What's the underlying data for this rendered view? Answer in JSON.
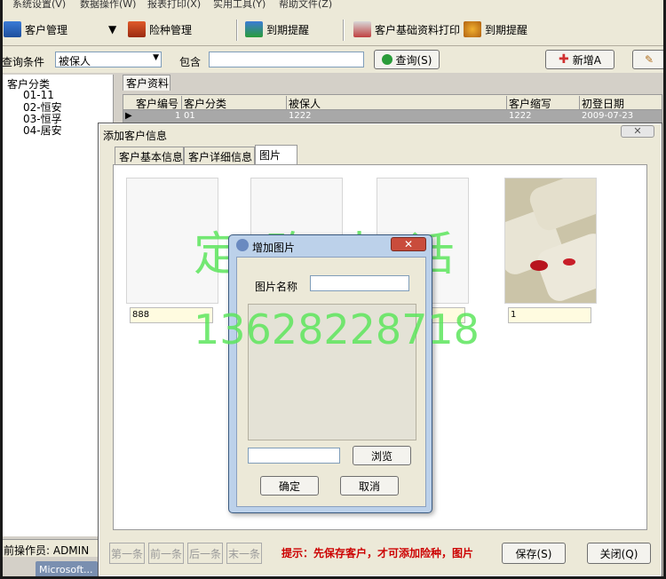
{
  "menu": [
    "系统设置(V)",
    "数据操作(W)",
    "报表打印(X)",
    "实用工具(Y)",
    "帮助文件(Z)"
  ],
  "toolbar": {
    "customer_mgmt": "客户管理",
    "insurance_mgmt": "险种管理",
    "due_reminder_1": "到期提醒",
    "print_basic": "客户基础资料打印",
    "due_reminder_2": "到期提醒"
  },
  "query": {
    "label": "查询条件",
    "field_value": "被保人",
    "contains_label": "包含",
    "search_value": "",
    "search_button": "查询(S)",
    "add_button": "新增A"
  },
  "tree": {
    "root": "客户分类",
    "items": [
      "01-11",
      "02-恒安",
      "03-恒孚",
      "04-居安"
    ]
  },
  "grid": {
    "tab": "客户资料",
    "headers": [
      "客户编号",
      "客户分类",
      "被保人",
      "客户缩写",
      "初登日期"
    ],
    "row": {
      "index": "1",
      "category": "01",
      "insured": "1222",
      "abbr": "1222",
      "date": "2009-07-23"
    }
  },
  "status": {
    "operator": "前操作员: ADMIN",
    "taskbar": "Microsoft..."
  },
  "dialog": {
    "title": "添加客户信息",
    "tabs": [
      "客户基本信息",
      "客户详细信息",
      "图片"
    ],
    "photo_names": [
      "888",
      "",
      "",
      "1"
    ],
    "nav": [
      "第一条",
      "前一条",
      "后一条",
      "末一条"
    ],
    "hint": "提示：先保存客户，才可添加险种，图片",
    "save": "保存(S)",
    "close": "关闭(Q)"
  },
  "add_picture": {
    "title": "增加图片",
    "name_label": "图片名称",
    "name_value": "",
    "path_value": "",
    "browse": "浏览",
    "ok": "确定",
    "cancel": "取消"
  },
  "watermark": {
    "line1": "定 购 电 话",
    "line2": "13628228718"
  },
  "colors": {
    "hint": "#cc0000",
    "watermark": "#5de65d",
    "dialog2_title": "#bcd1ea"
  }
}
